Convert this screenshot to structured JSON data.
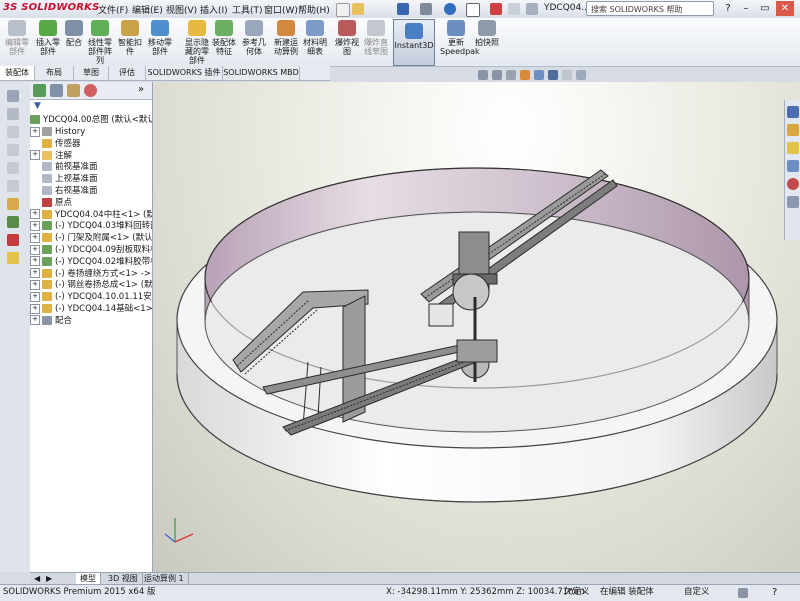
{
  "app": {
    "logo": "SOLIDWORKS",
    "doc_title": "YDCQ04...",
    "search_placeholder": "搜索 SOLIDWORKS 帮助"
  },
  "menu": [
    "文件(F)",
    "编辑(E)",
    "视图(V)",
    "插入(I)",
    "工具(T)",
    "窗口(W)",
    "帮助(H)"
  ],
  "command_manager": {
    "buttons": [
      "编辑零部件",
      "插入零部件",
      "配合",
      "线性零部件阵列",
      "智能扣件",
      "移动零部件",
      "显示隐藏的零部件",
      "装配体特征",
      "参考几何体",
      "新建运动算例",
      "材料明细表",
      "爆炸视图",
      "爆炸直线草图",
      "Instant3D",
      "更新Speedpak",
      "拍快照"
    ]
  },
  "command_tabs": [
    "装配体",
    "布局",
    "草图",
    "评估",
    "SOLIDWORKS 插件",
    "SOLIDWORKS MBD"
  ],
  "tree": {
    "root": "YDCQ04.00总图  (默认<默认_",
    "items": [
      {
        "label": "History",
        "expander": "+"
      },
      {
        "label": "传感器",
        "expander": ""
      },
      {
        "label": "注解",
        "expander": "+"
      },
      {
        "label": "前视基准面",
        "expander": ""
      },
      {
        "label": "上视基准面",
        "expander": ""
      },
      {
        "label": "右视基准面",
        "expander": ""
      },
      {
        "label": "原点",
        "expander": ""
      },
      {
        "label": "YDCQ04.04中柱<1> (默认",
        "expander": "+"
      },
      {
        "label": "(-) YDCQ04.03堆料回转部",
        "expander": "+"
      },
      {
        "label": "(-) 门架及附属<1> (默认<",
        "expander": "+"
      },
      {
        "label": "(-) YDCQ04.09刮板取料机",
        "expander": "+"
      },
      {
        "label": "(-) YDCQ04.02堆料胶带机",
        "expander": "+"
      },
      {
        "label": "(-) 卷扬缠绕方式<1> -> (",
        "expander": "+"
      },
      {
        "label": "(-) 钢丝卷扬总成<1> (默认",
        "expander": "+"
      },
      {
        "label": "(-) YDCQ04.10.01.11安幅",
        "expander": "+"
      },
      {
        "label": "(-) YDCQ04.14基础<1> (",
        "expander": "+"
      },
      {
        "label": "配合",
        "expander": "+"
      }
    ]
  },
  "bottom_tabs": [
    "模型",
    "3D 视图",
    "运动算例 1"
  ],
  "status": {
    "product": "SOLIDWORKS Premium 2015 x64 版",
    "coords": "X: -34298.11mm Y: 25362mm Z: 10034.71mm",
    "defined": "欠定义",
    "editing": "在编辑 装配体",
    "units": "自定义"
  },
  "colors": {
    "ring_outer": "#f7f7f7",
    "ring_inner": "#c6b4c2",
    "machine": "#3a3a3a"
  }
}
